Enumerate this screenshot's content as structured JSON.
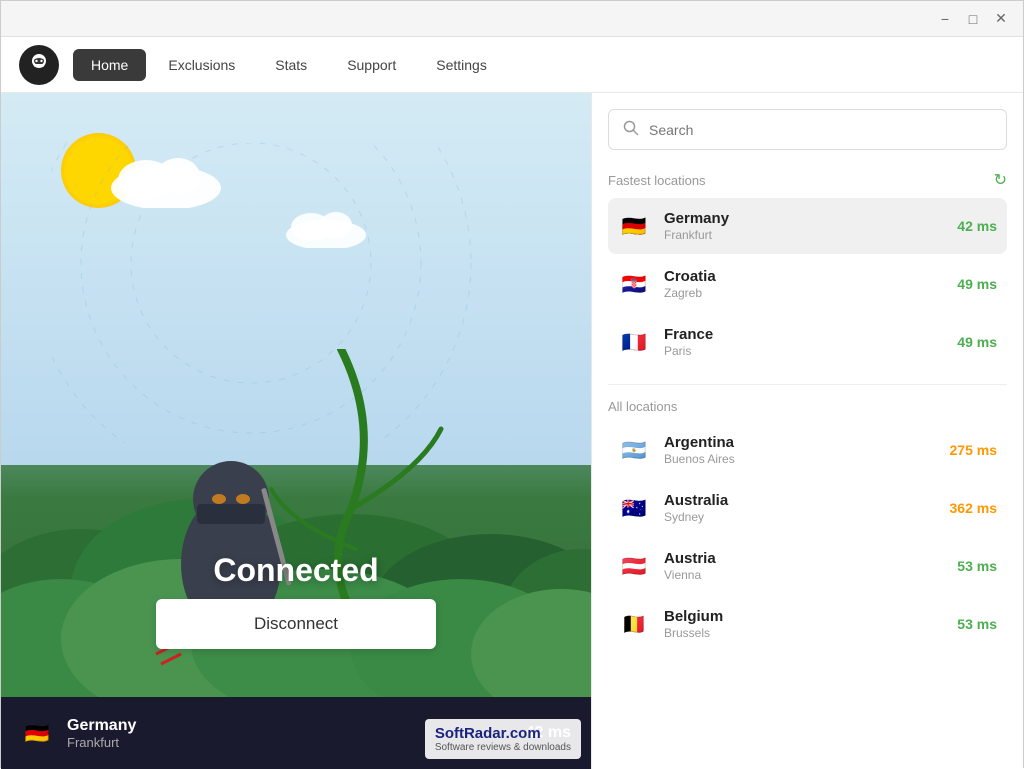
{
  "window": {
    "minimize_label": "−",
    "maximize_label": "□",
    "close_label": "✕"
  },
  "navbar": {
    "tabs": [
      {
        "id": "home",
        "label": "Home",
        "active": true
      },
      {
        "id": "exclusions",
        "label": "Exclusions",
        "active": false
      },
      {
        "id": "stats",
        "label": "Stats",
        "active": false
      },
      {
        "id": "support",
        "label": "Support",
        "active": false
      },
      {
        "id": "settings",
        "label": "Settings",
        "active": false
      }
    ]
  },
  "hero": {
    "status": "Connected",
    "disconnect_label": "Disconnect"
  },
  "status_bar": {
    "country": "Germany",
    "city": "Frankfurt",
    "ping": "42 ms",
    "flag": "🇩🇪"
  },
  "search": {
    "placeholder": "Search"
  },
  "fastest_section": {
    "title": "Fastest locations",
    "locations": [
      {
        "country": "Germany",
        "city": "Frankfurt",
        "ping": "42 ms",
        "ping_class": "ping-green",
        "flag": "🇩🇪",
        "selected": true
      },
      {
        "country": "Croatia",
        "city": "Zagreb",
        "ping": "49 ms",
        "ping_class": "ping-green",
        "flag": "🇭🇷",
        "selected": false
      },
      {
        "country": "France",
        "city": "Paris",
        "ping": "49 ms",
        "ping_class": "ping-green",
        "flag": "🇫🇷",
        "selected": false
      }
    ]
  },
  "all_section": {
    "title": "All locations",
    "locations": [
      {
        "country": "Argentina",
        "city": "Buenos Aires",
        "ping": "275 ms",
        "ping_class": "ping-orange",
        "flag": "🇦🇷",
        "selected": false
      },
      {
        "country": "Australia",
        "city": "Sydney",
        "ping": "362 ms",
        "ping_class": "ping-orange",
        "flag": "🇦🇺",
        "selected": false
      },
      {
        "country": "Austria",
        "city": "Vienna",
        "ping": "53 ms",
        "ping_class": "ping-green",
        "flag": "🇦🇹",
        "selected": false
      },
      {
        "country": "Belgium",
        "city": "Brussels",
        "ping": "53 ms",
        "ping_class": "ping-green",
        "flag": "🇧🇪",
        "selected": false
      }
    ]
  },
  "watermark": {
    "title": "SoftRadar.com",
    "subtitle": "Software reviews & downloads"
  },
  "colors": {
    "accent_green": "#4CAF50",
    "accent_orange": "#FF9800",
    "nav_active_bg": "#3a3a3a",
    "status_bar_bg": "#1a1a2e"
  }
}
